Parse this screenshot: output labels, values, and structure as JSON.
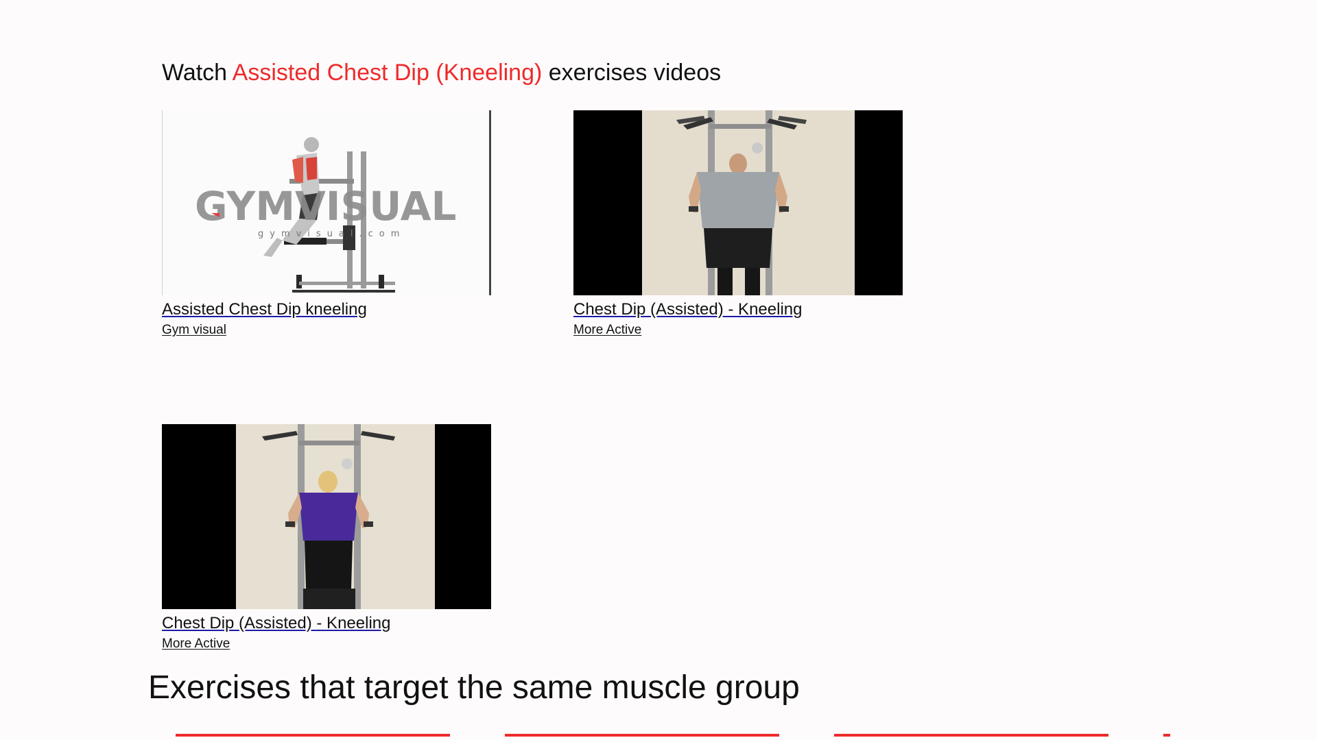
{
  "videos_section": {
    "heading_prefix": "Watch ",
    "heading_exercise": "Assisted Chest Dip (Kneeling)",
    "heading_suffix": " exercises videos",
    "videos": [
      {
        "title": "Assisted Chest Dip kneeling",
        "channel": "Gym visual",
        "watermark": "GYMVISUAL",
        "watermark_sub": "gymvisual.com"
      },
      {
        "title": "Chest Dip (Assisted) - Kneeling",
        "channel": "More Active"
      },
      {
        "title": "Chest Dip (Assisted) - Kneeling",
        "channel": "More Active"
      }
    ]
  },
  "same_muscle_section": {
    "heading": "Exercises that target the same muscle group"
  },
  "colors": {
    "accent": "#ee2a2a",
    "background": "#fefbfc",
    "text": "#111111",
    "link_underline": "#1a1aa6"
  }
}
